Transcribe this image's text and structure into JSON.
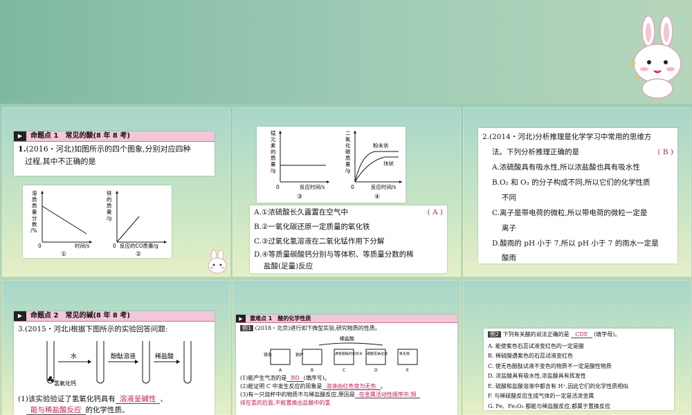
{
  "slide1": {
    "section_label": "命题点 1　常见的酸(8 年 8 考)",
    "q_num": "1.",
    "q_src": "(2016・河北)",
    "q_text1": "如图所示的四个图象,分别对应四种",
    "q_text2": "过程,其中不正确的是",
    "g1": {
      "ylabel": [
        "溶",
        "质",
        "质",
        "量",
        "分",
        "数",
        "/%"
      ],
      "origin": "0",
      "xlabel": "时间/s",
      "num": "①"
    },
    "g2": {
      "ylabel": [
        "铁",
        "的",
        "质",
        "量",
        "/g"
      ],
      "origin": "0",
      "xlabel": "反应的CO质量/g",
      "num": "②"
    }
  },
  "slide2": {
    "g3": {
      "ylabel": [
        "锰",
        "元",
        "素",
        "的",
        "质",
        "量",
        "/g"
      ],
      "origin": "0",
      "xlabel": "反应时间/s",
      "num": "③"
    },
    "g4": {
      "ylabel": [
        "二",
        "氧",
        "化",
        "碳",
        "质",
        "量",
        "/g"
      ],
      "origin": "0",
      "xlabel": "反应时间/s",
      "num": "④",
      "curve1": "粉末状",
      "curve2": "块状"
    },
    "answer": "( A )",
    "optA": "A.①浓硫酸长久露置在空气中",
    "optB": "B.②一氧化碳还原一定质量的氧化铁",
    "optC": "C.③过氧化氢溶液在二氧化锰作用下分解",
    "optD1": "D.④等质量碳酸钙分别与等体积、等质量分数的稀",
    "optD2": "盐酸(足量)反应"
  },
  "slide3": {
    "q_line1": "2.(2014・河北)分析推理是化学学习中常用的思维方",
    "q_line2": "法。下列分析推理正确的是",
    "answer": "( B )",
    "optA": "A.浓硫酸具有吸水性,所以浓盐酸也具有吸水性",
    "optB1": "B.O₂ 和 O₃ 的分子构成不同,所以它们的化学性质",
    "optB2": "不同",
    "optC1": "C.离子是带电荷的微粒,所以带电荷的微粒一定是",
    "optC2": "离子",
    "optD1": "D.酸雨的 pH 小于 7,所以 pH 小于 7 的雨水一定是",
    "optD2": "酸雨"
  },
  "slide4": {
    "section_label": "命题点 2　常见的碱(8 年 8 考)",
    "q_line": "3.(2015・河北)根据下图所示的实验回答问题:",
    "water": "水",
    "phenol": "酚酞溶液",
    "hcl": "稀盐酸",
    "caoh": "氢氧化钙",
    "sub1_pre": "(1)该实验验证了氢氧化钙具有",
    "sub1_ans": "溶液呈碱性",
    "sub1_sep": "、",
    "sub2_ans": "能与稀盐酸反应",
    "sub2_post": "的化学性质。"
  },
  "slide5": {
    "section_label": "重难点 1　酸的化学性质",
    "ex_label": "例1",
    "ex_text": "(2018・北京)进行如下微型实验,研究物质的性质。",
    "acid_label": "稀盐酸",
    "tubes": [
      "A",
      "B",
      "C",
      "D",
      "E"
    ],
    "tube_notes": [
      "镁条",
      "铜片",
      "滴有酚酞的石灰水",
      "碳酸氢钠溶液",
      "氧化铁"
    ],
    "sub1_pre": "(1)能产生气泡的是",
    "sub1_ans": "BD",
    "sub1_post": "(填序号)。",
    "sub2_pre": "(2)能证明 C 中发生反应的现象是",
    "sub2_ans": "溶液由红色变为无色",
    "sub2_post": "。",
    "sub3_pre": "(3)有一只烧杯中的物质不与稀盐酸反应,原因是",
    "sub3_ans": "在金属活动性顺序中,铜",
    "sub3_ans2": "排在氢的后面,不能置换出盐酸中的氢"
  },
  "slide6": {
    "ex_label": "例2",
    "ex_text": "下列有关酸的说法正确的是",
    "ex_ans": "CDE",
    "ex_post": "(填字母)。",
    "opts": [
      "A. 能使紫色石蕊试液变红色的一定是酸",
      "B. 稀硫酸遇紫色的石蕊试液变红色",
      "C. 使无色酚酞试液不变色的物质不一定是酸性物质",
      "D. 浓盐酸具有吸水性,浓盐酸具有挥发性",
      "E. 硫酸和盐酸溶液中都含有 H⁺,因此它们的化学性质相似",
      "F. 与稀硫酸反应生成气体的一定是活泼金属",
      "G. Fe、Fe₂O₃ 都能与稀盐酸反应,都属于置换反应"
    ]
  }
}
